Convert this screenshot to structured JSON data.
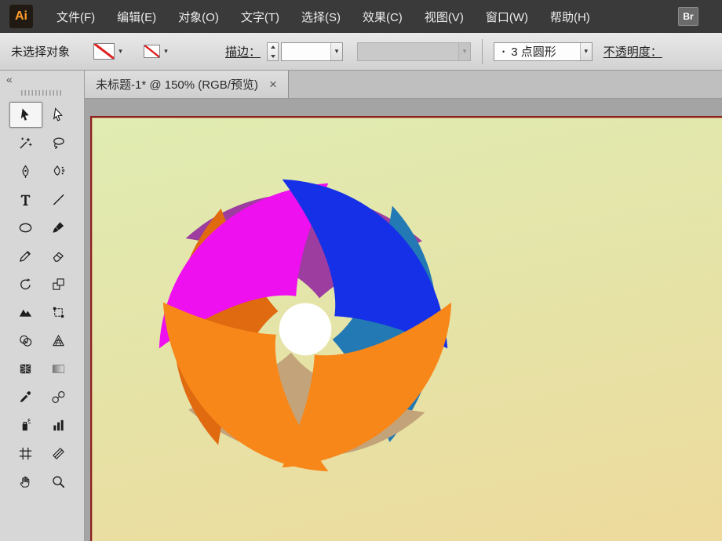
{
  "menubar": {
    "logo": "Ai",
    "items": [
      {
        "id": "file",
        "label": "文件(F)"
      },
      {
        "id": "edit",
        "label": "编辑(E)"
      },
      {
        "id": "object",
        "label": "对象(O)"
      },
      {
        "id": "type",
        "label": "文字(T)"
      },
      {
        "id": "select",
        "label": "选择(S)"
      },
      {
        "id": "effect",
        "label": "效果(C)"
      },
      {
        "id": "view",
        "label": "视图(V)"
      },
      {
        "id": "window",
        "label": "窗口(W)"
      },
      {
        "id": "help",
        "label": "帮助(H)"
      }
    ],
    "bridge_badge": "Br"
  },
  "controlbar": {
    "status": "未选择对象",
    "stroke_label": "描边：",
    "brush_dot": "•",
    "brush_label": "3 点圆形",
    "opacity_label": "不透明度："
  },
  "tabbar": {
    "tabs": [
      {
        "title": "未标题-1* @ 150% (RGB/预览)",
        "close": "×",
        "active": true
      }
    ]
  },
  "toolbar": {
    "collapse": "«",
    "tools": [
      {
        "name": "selection",
        "selected": true
      },
      {
        "name": "direct-selection"
      },
      {
        "name": "magic-wand"
      },
      {
        "name": "lasso"
      },
      {
        "name": "pen"
      },
      {
        "name": "curvature"
      },
      {
        "name": "type"
      },
      {
        "name": "line"
      },
      {
        "name": "ellipse"
      },
      {
        "name": "paintbrush"
      },
      {
        "name": "pencil"
      },
      {
        "name": "eraser"
      },
      {
        "name": "rotate"
      },
      {
        "name": "scale"
      },
      {
        "name": "width"
      },
      {
        "name": "free-transform"
      },
      {
        "name": "shape-builder"
      },
      {
        "name": "perspective-grid"
      },
      {
        "name": "mesh"
      },
      {
        "name": "gradient"
      },
      {
        "name": "eyedropper"
      },
      {
        "name": "blend"
      },
      {
        "name": "symbol-sprayer"
      },
      {
        "name": "column-graph"
      },
      {
        "name": "artboard"
      },
      {
        "name": "slice"
      },
      {
        "name": "hand"
      },
      {
        "name": "zoom"
      }
    ]
  },
  "ui": {
    "chevron": "▾"
  },
  "canvas": {
    "petals_front": {
      "top_left": "#ee10ee",
      "top_right": "#1530e6",
      "bottom_right": "#f8871a",
      "bottom_left": "#f8871a"
    },
    "petals_back": {
      "top": "#9d3da0",
      "right": "#2379b3",
      "bottom": "#c3a37a",
      "left": "#e06a10"
    },
    "center_hole": "#ffffff",
    "background_top": "#e0ecb2",
    "background_bottom": "#eeda9c",
    "artboard_border": "#8e1f1f"
  }
}
